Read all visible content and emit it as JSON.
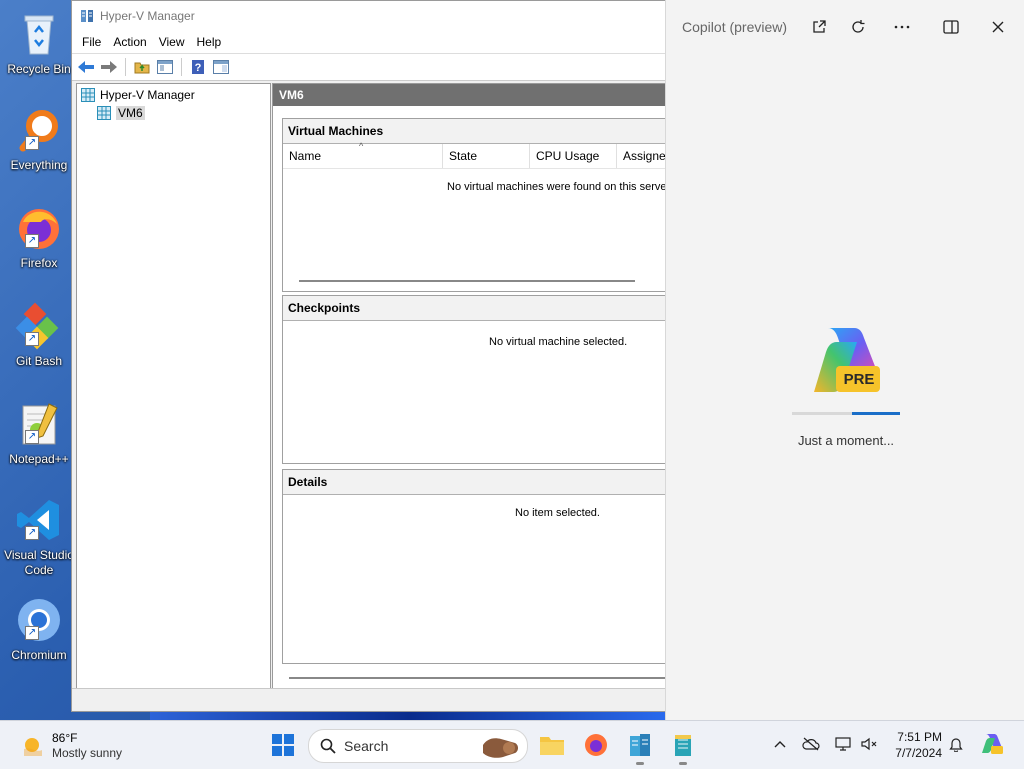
{
  "desktop": {
    "icons": [
      {
        "label": "Recycle Bin",
        "icon": "recycle-bin-icon"
      },
      {
        "label": "Everything",
        "icon": "search-magnifier-icon"
      },
      {
        "label": "Firefox",
        "icon": "firefox-icon"
      },
      {
        "label": "Git Bash",
        "icon": "git-icon"
      },
      {
        "label": "Notepad++",
        "icon": "notepad-plus-plus-icon"
      },
      {
        "label": "Visual Studio Code",
        "icon": "vscode-icon"
      },
      {
        "label": "Chromium",
        "icon": "chromium-icon"
      }
    ]
  },
  "hyperv": {
    "title": "Hyper-V Manager",
    "menu": [
      "File",
      "Action",
      "View",
      "Help"
    ],
    "toolbar": [
      "back-arrow-icon",
      "forward-arrow-icon",
      "folder-up-icon",
      "show-hide-tree-icon",
      "help-icon",
      "action-pane-icon"
    ],
    "tree": {
      "root": "Hyper-V Manager",
      "child": "VM6"
    },
    "content_title": "VM6",
    "vm_pane": {
      "title": "Virtual Machines",
      "columns": [
        "Name",
        "State",
        "CPU Usage",
        "Assigne"
      ],
      "empty_msg": "No virtual machines were found on this server."
    },
    "checkpoints_pane": {
      "title": "Checkpoints",
      "empty_msg": "No virtual machine selected."
    },
    "details_pane": {
      "title": "Details",
      "empty_msg": "No item selected."
    }
  },
  "copilot": {
    "title": "Copilot (preview)",
    "badge": "PRE",
    "status": "Just a moment...",
    "progress": 0.44
  },
  "taskbar": {
    "weather": {
      "temp": "86°F",
      "desc": "Mostly sunny"
    },
    "search_placeholder": "Search",
    "time": "7:51 PM",
    "date": "7/7/2024",
    "accent": "#1e74d9"
  }
}
